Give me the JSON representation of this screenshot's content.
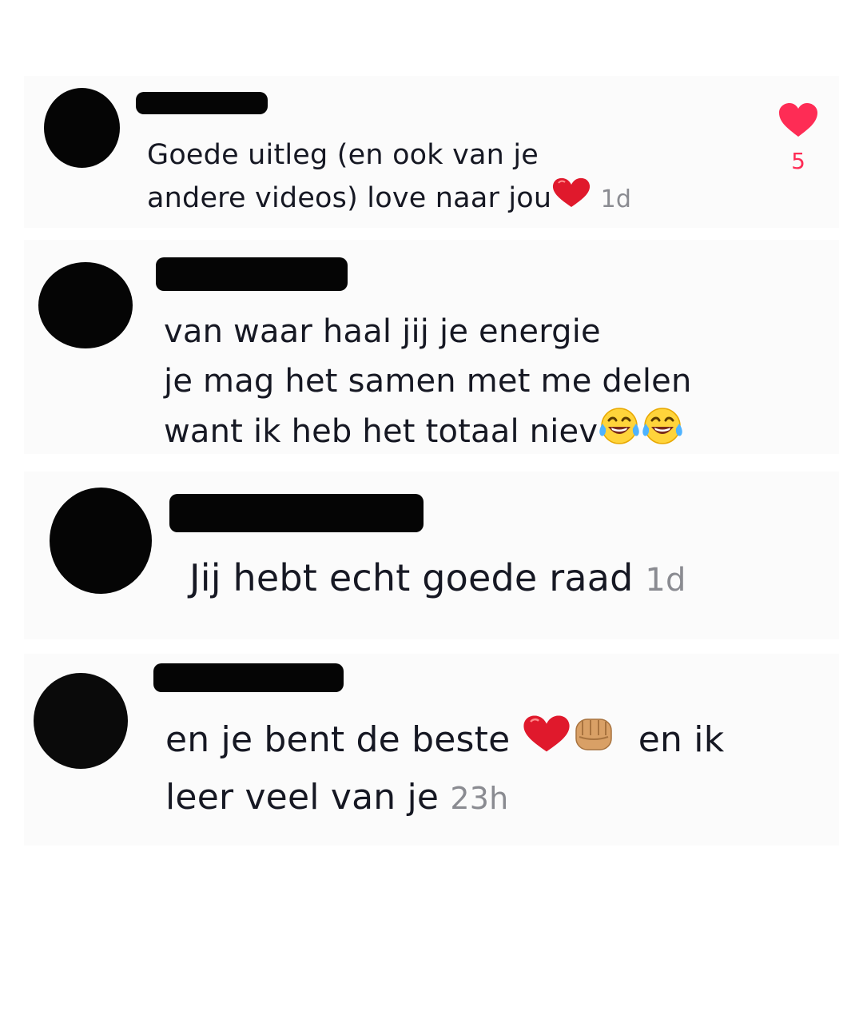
{
  "comments": [
    {
      "lines": [
        "Goede uitleg (en ook van je",
        "andere videos) love naar jou"
      ],
      "emoji": [
        "red-heart-emoji"
      ],
      "time": "1d",
      "likes": "5",
      "liked": true
    },
    {
      "lines": [
        "van waar haal jij je energie",
        "je mag het samen met me delen",
        "want ik heb het totaal niev"
      ],
      "emoji": [
        "face-with-tears-of-joy-emoji",
        "face-with-tears-of-joy-emoji"
      ]
    },
    {
      "lines": [
        "Jij hebt echt goede raad"
      ],
      "time": "1d"
    },
    {
      "lines": [
        "en je bent de beste",
        "en ik",
        "leer veel van je"
      ],
      "emoji": [
        "red-heart-emoji",
        "oncoming-fist-emoji"
      ],
      "time": "23h"
    }
  ],
  "colors": {
    "like": "#fe2c55",
    "timestamp": "#8a8b91",
    "text": "#161823",
    "redaction": "#050505"
  }
}
